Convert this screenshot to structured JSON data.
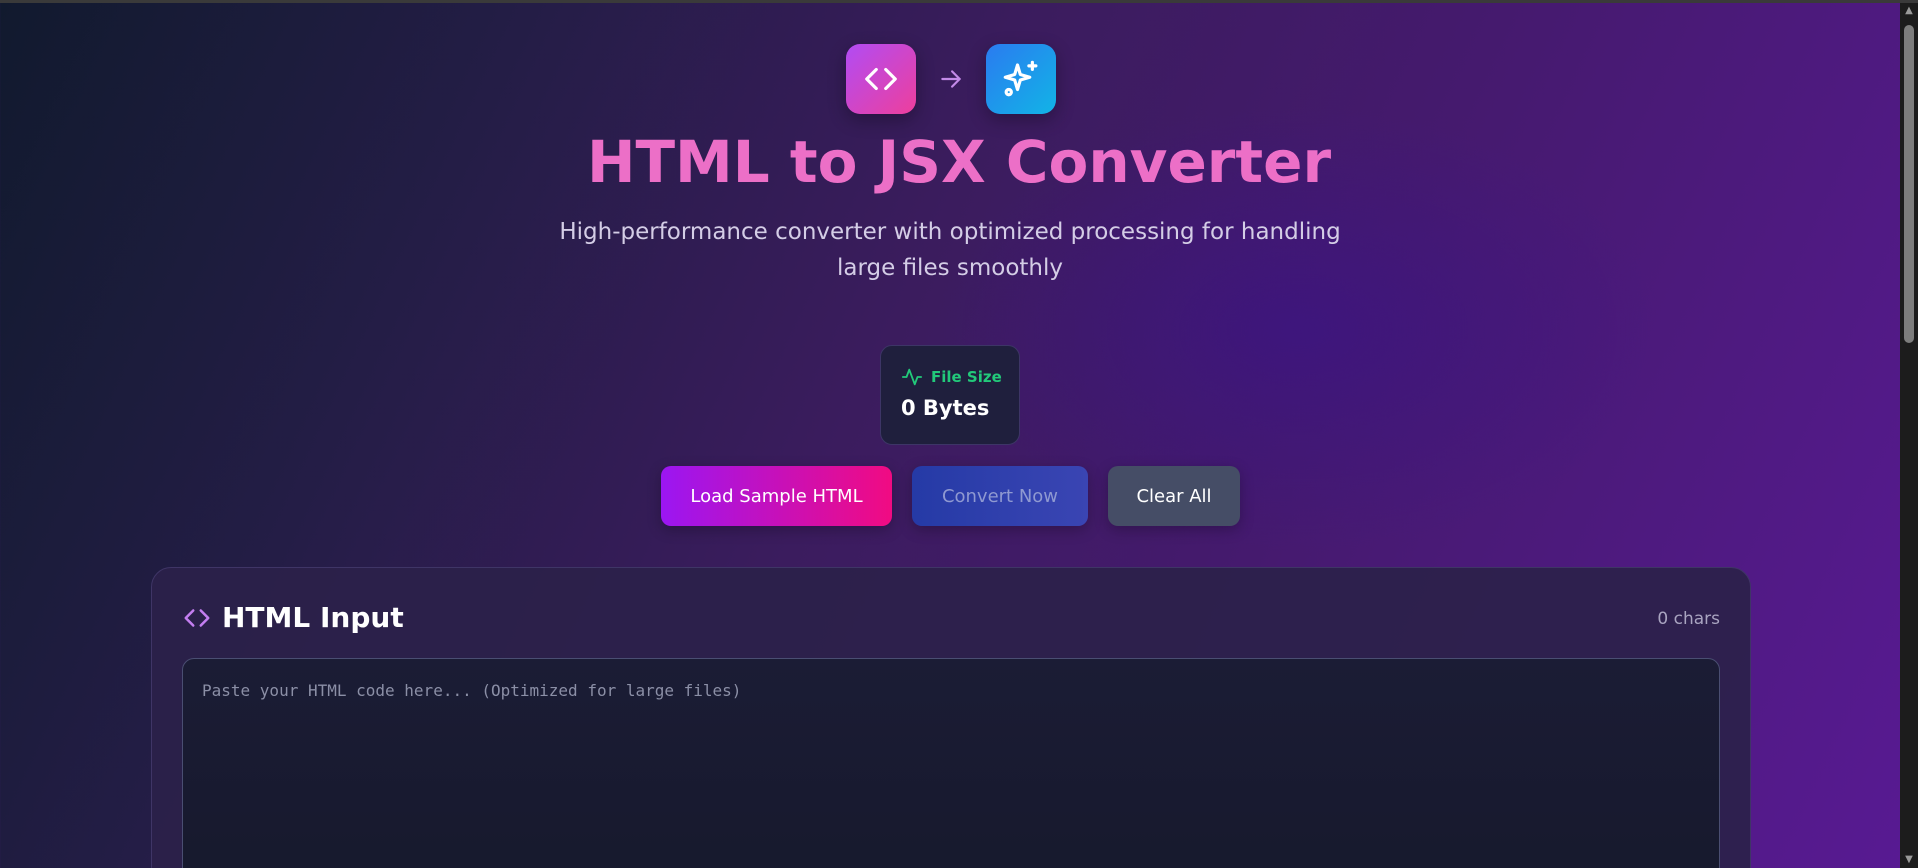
{
  "header": {
    "title": "HTML to JSX Converter",
    "subtitle": "High-performance converter with optimized processing for handling large files smoothly",
    "icons": [
      "code-icon",
      "arrow-right-icon",
      "sparkles-icon"
    ]
  },
  "stats": {
    "file_size_label": "File Size",
    "file_size_value": "0 Bytes",
    "icon": "activity-icon",
    "accent": "#22c97a"
  },
  "actions": {
    "load_sample": "Load Sample HTML",
    "convert": "Convert Now",
    "clear": "Clear All"
  },
  "input_panel": {
    "title": "HTML Input",
    "char_count": "0 chars",
    "value": "",
    "placeholder": "Paste your HTML code here... (Optimized for large files)",
    "icon": "code-icon"
  },
  "colors": {
    "title": "#ec6fc7",
    "sample_button_gradient": [
      "#9b16f2",
      "#f10b82"
    ],
    "convert_button": "#2b3eab",
    "clear_button": "#454d66"
  }
}
